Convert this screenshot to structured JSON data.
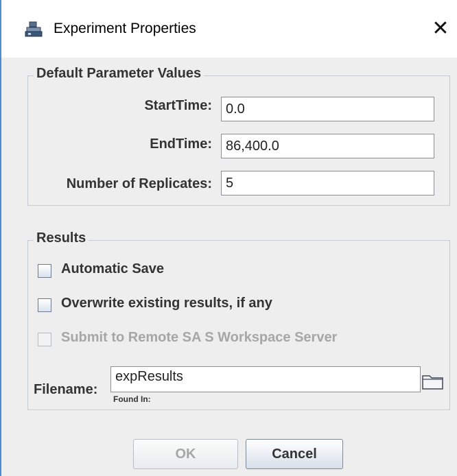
{
  "window": {
    "title": "Experiment Properties",
    "close_glyph": "✕",
    "icon": "app-icon"
  },
  "defaults": {
    "group_title": "Default Parameter Values",
    "start_time": {
      "label": "StartTime:",
      "value": "0.0"
    },
    "end_time": {
      "label": "EndTime:",
      "value": "86,400.0"
    },
    "replicates": {
      "label": "Number of Replicates:",
      "value": "5"
    }
  },
  "results": {
    "group_title": "Results",
    "automatic_save": {
      "label": "Automatic Save",
      "checked": false
    },
    "overwrite": {
      "label": "Overwrite existing results, if any",
      "checked": false
    },
    "remote": {
      "label": "Submit to Remote SA S Workspace Server",
      "checked": false,
      "disabled": true
    },
    "filename": {
      "label": "Filename:",
      "value": "expResults",
      "found_in": "Found In:",
      "browse_icon": "folder-icon"
    }
  },
  "buttons": {
    "ok": {
      "label": "OK",
      "disabled": true
    },
    "cancel": {
      "label": "Cancel"
    }
  },
  "colors": {
    "accent_border": "#4a8fd6",
    "dialog_bg": "#eeeeee",
    "group_border": "#c5c9d1"
  }
}
